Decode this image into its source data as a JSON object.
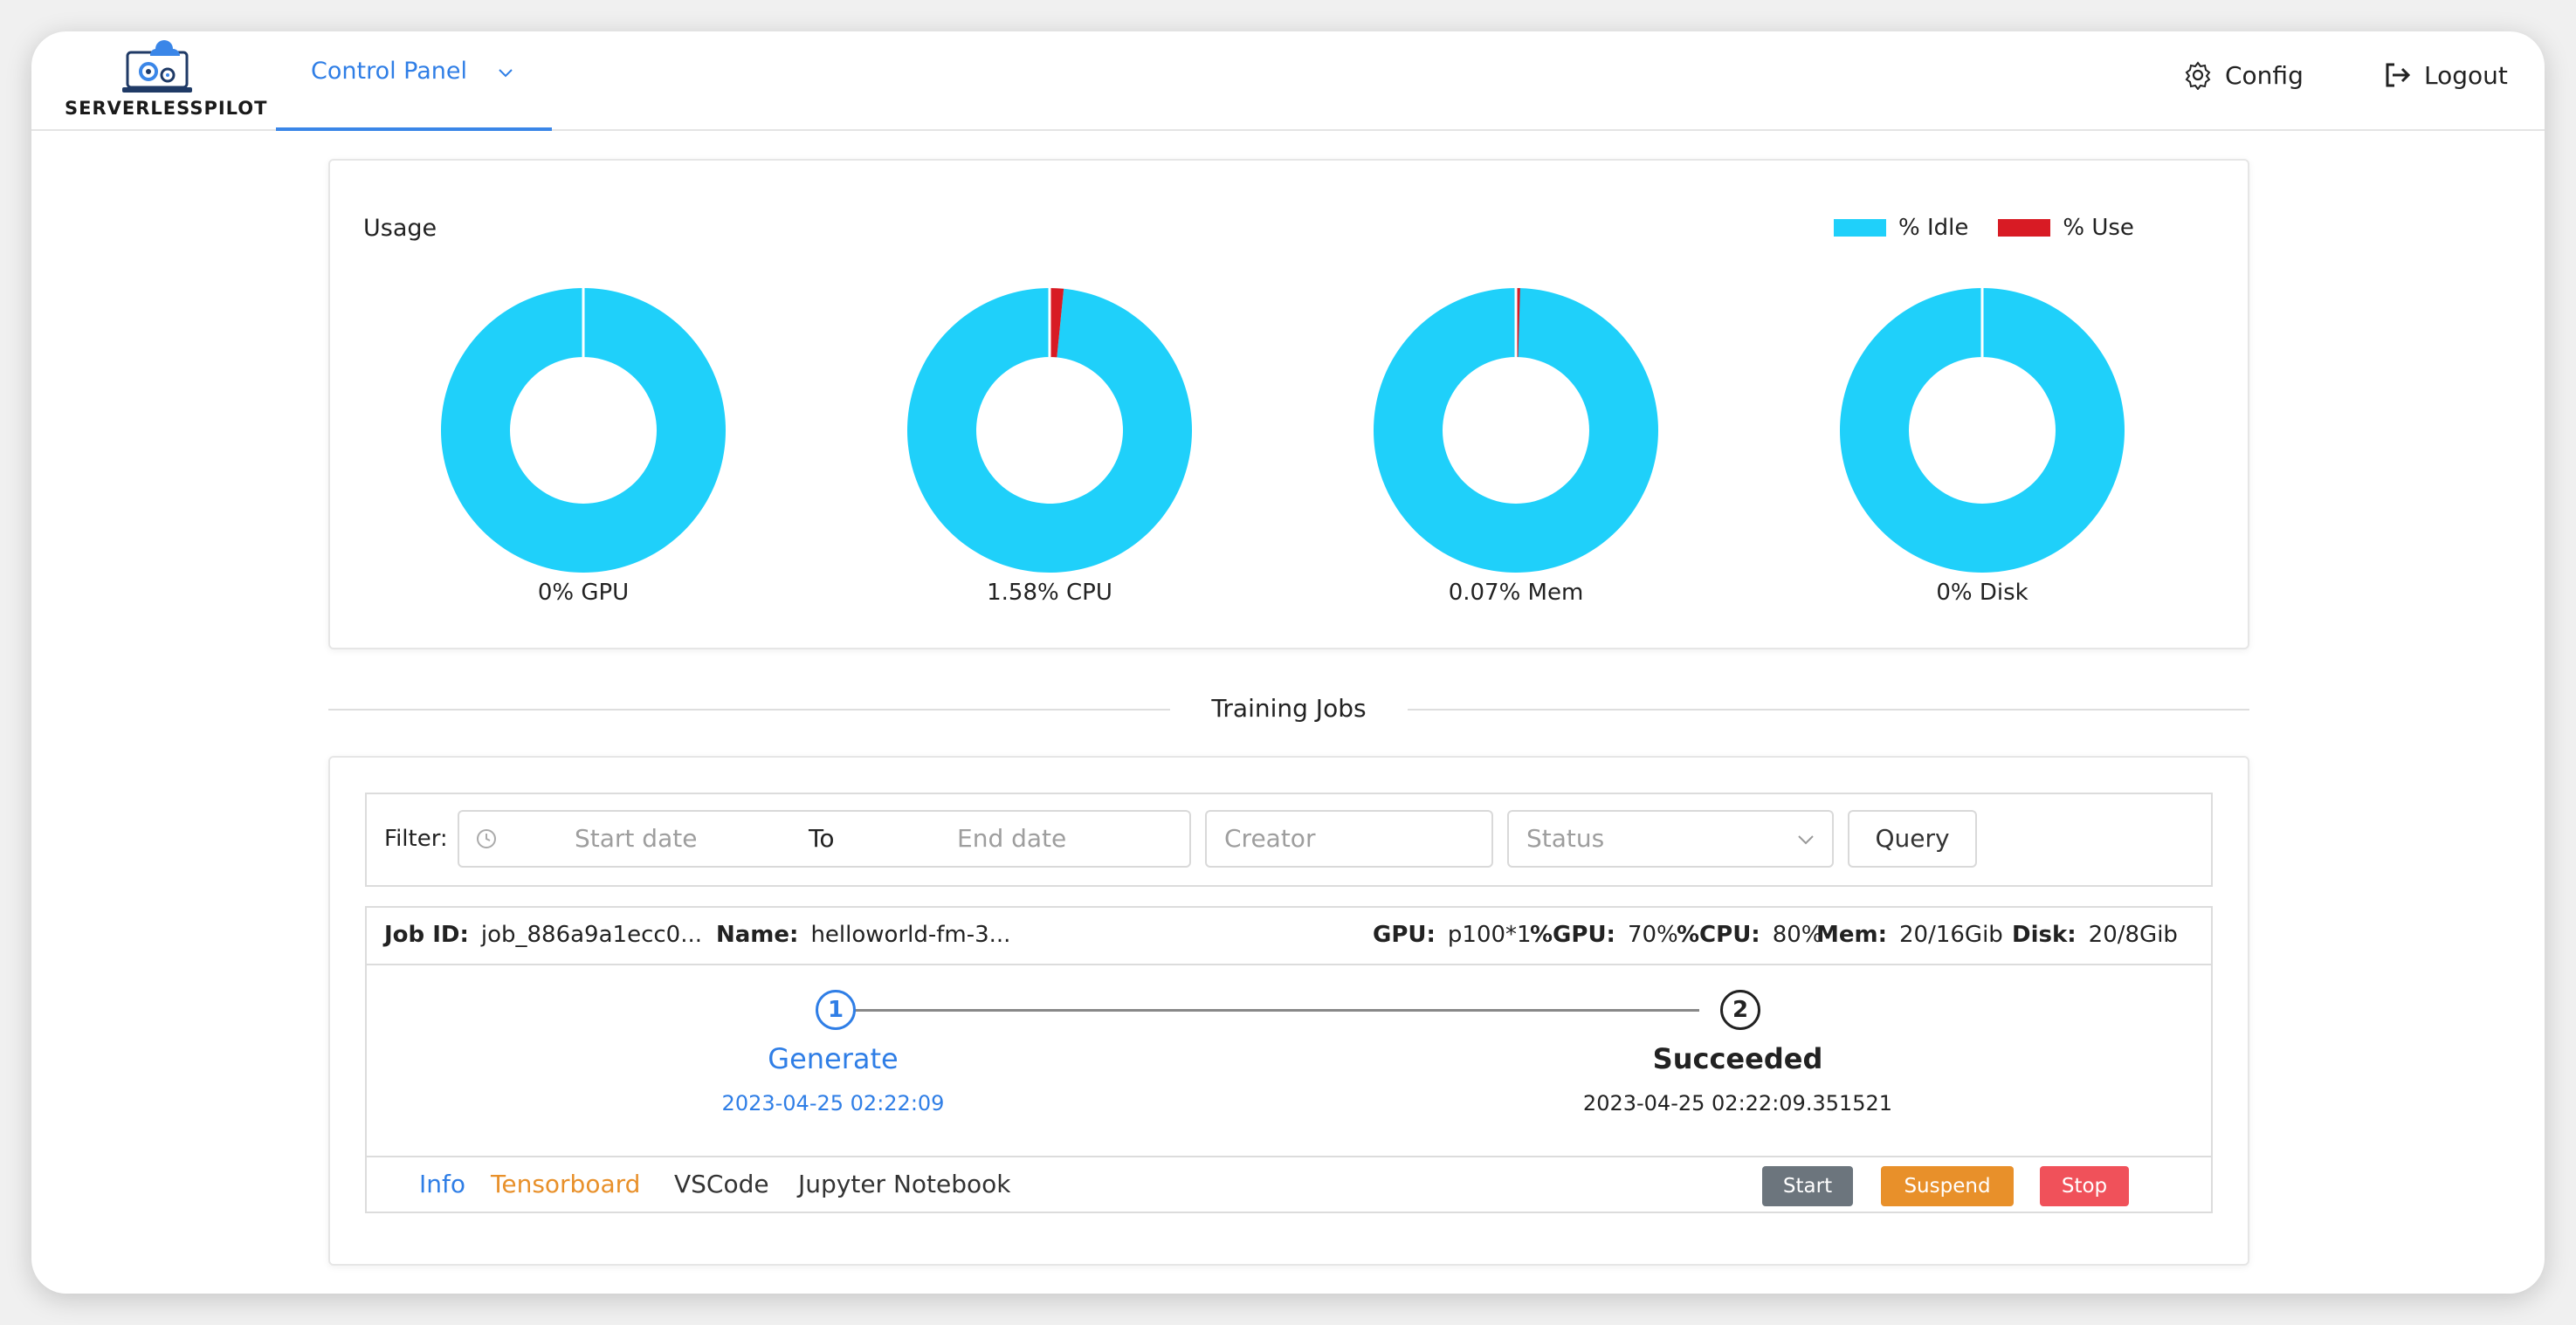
{
  "header": {
    "logo_text": "SERVERLESSPILOT",
    "nav_tab_label": "Control Panel",
    "config_label": "Config",
    "logout_label": "Logout"
  },
  "usage": {
    "title": "Usage",
    "legend": {
      "idle_label": "% Idle",
      "use_label": "% Use"
    },
    "colors": {
      "idle": "#1fd0fa",
      "use": "#d81b24"
    }
  },
  "chart_data": {
    "type": "pie",
    "donuts": [
      {
        "label": "0% GPU",
        "use_pct": 0
      },
      {
        "label": "1.58% CPU",
        "use_pct": 1.58
      },
      {
        "label": "0.07% Mem",
        "use_pct": 0.07
      },
      {
        "label": "0% Disk",
        "use_pct": 0
      }
    ],
    "legend": [
      "% Idle",
      "% Use"
    ]
  },
  "section_title": "Training Jobs",
  "filter": {
    "label": "Filter:",
    "start_placeholder": "Start date",
    "to_label": "To",
    "end_placeholder": "End date",
    "creator_placeholder": "Creator",
    "status_placeholder": "Status",
    "query_label": "Query"
  },
  "job": {
    "id_key": "Job ID:",
    "id_value": "job_886a9a1ecc0...",
    "name_key": "Name:",
    "name_value": "helloworld-fm-3...",
    "gpu_key": "GPU:",
    "gpu_value": "p100*1",
    "pgpu_key": "%GPU:",
    "pgpu_value": "70%",
    "pcpu_key": "%CPU:",
    "pcpu_value": "80%",
    "mem_key": "Mem:",
    "mem_value": "20/16Gib",
    "disk_key": "Disk:",
    "disk_value": "20/8Gib",
    "steps": [
      {
        "num": "1",
        "title": "Generate",
        "date": "2023-04-25 02:22:09"
      },
      {
        "num": "2",
        "title": "Succeeded",
        "date": "2023-04-25 02:22:09.351521"
      }
    ],
    "links": {
      "info": "Info",
      "tensorboard": "Tensorboard",
      "vscode": "VSCode",
      "jupyter": "Jupyter Notebook"
    },
    "buttons": {
      "start": "Start",
      "suspend": "Suspend",
      "stop": "Stop"
    },
    "colors": {
      "blue": "#2f7ee6",
      "orange": "#e8902a",
      "start_btn": "#6c757d",
      "suspend_btn": "#e8902a",
      "stop_btn": "#f0515a"
    }
  }
}
